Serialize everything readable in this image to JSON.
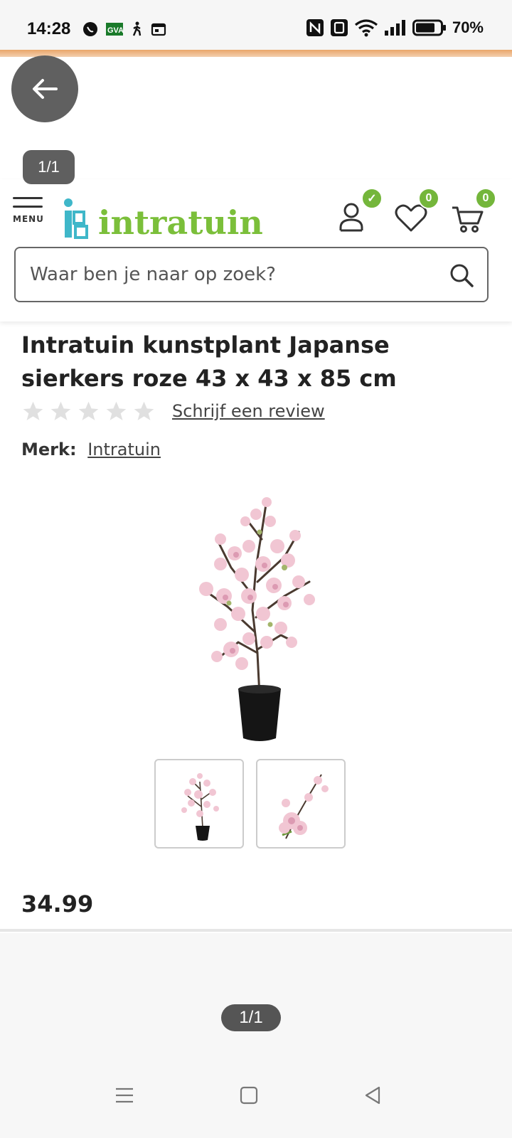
{
  "status_bar": {
    "time": "14:28",
    "battery": "70%",
    "left_icons": [
      "whatsapp-icon",
      "gva-icon",
      "walk-icon",
      "calendar-icon"
    ],
    "right_icons": [
      "nfc-icon",
      "nfc-alt-icon",
      "wifi-icon",
      "signal-icon",
      "battery-icon"
    ]
  },
  "viewer": {
    "counter_top": "1/1",
    "counter_bottom": "1/1"
  },
  "header": {
    "menu_label": "MENU",
    "logo_text": "intratuin",
    "account_badge": "✓",
    "wishlist_badge": "0",
    "cart_badge": "0"
  },
  "search": {
    "placeholder": "Waar ben je naar op zoek?"
  },
  "product": {
    "title": "Intratuin kunstplant Japanse sierkers roze 43 x 43 x 85 cm",
    "rating_stars": 0,
    "review_link": "Schrijf een review",
    "brand_label": "Merk:",
    "brand_value": "Intratuin",
    "price": "34.99"
  },
  "colors": {
    "brand_green": "#74b63b",
    "brand_teal": "#3fb7c9",
    "accent_orange": "#e9a66a"
  }
}
